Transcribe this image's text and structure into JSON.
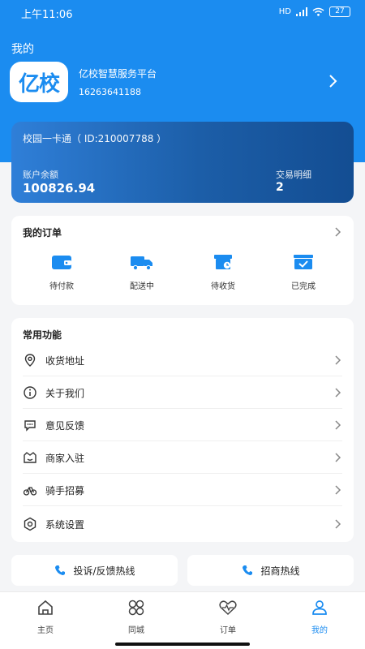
{
  "status_bar": {
    "time": "上午11:06",
    "network": "HD",
    "battery": "27"
  },
  "header": {
    "title": "我的",
    "logo_text": "亿校",
    "platform_name": "亿校智慧服务平台",
    "phone": "16263641188"
  },
  "card": {
    "title": "校园一卡通（ ID:210007788 ）",
    "balance_label": "账户余额",
    "balance_value": "100826.94",
    "transactions_label": "交易明细",
    "transactions_value": "2"
  },
  "orders": {
    "title": "我的订单",
    "items": [
      {
        "label": "待付款",
        "icon": "wallet-icon"
      },
      {
        "label": "配送中",
        "icon": "truck-icon"
      },
      {
        "label": "待收货",
        "icon": "package-clock-icon"
      },
      {
        "label": "已完成",
        "icon": "checked-box-icon"
      }
    ]
  },
  "functions": {
    "title": "常用功能",
    "items": [
      {
        "label": "收货地址",
        "icon": "location-icon"
      },
      {
        "label": "关于我们",
        "icon": "info-icon"
      },
      {
        "label": "意见反馈",
        "icon": "feedback-icon"
      },
      {
        "label": "商家入驻",
        "icon": "shop-icon"
      },
      {
        "label": "骑手招募",
        "icon": "bicycle-icon"
      },
      {
        "label": "系统设置",
        "icon": "settings-icon"
      }
    ]
  },
  "hotlines": {
    "complaint": "投诉/反馈热线",
    "business": "招商热线"
  },
  "tabbar": {
    "items": [
      {
        "label": "主页",
        "icon": "home-icon"
      },
      {
        "label": "同城",
        "icon": "grid-icon"
      },
      {
        "label": "订单",
        "icon": "heart-pulse-icon"
      },
      {
        "label": "我的",
        "icon": "person-icon"
      }
    ],
    "active": "我的"
  },
  "colors": {
    "primary": "#1b8cf0",
    "card_gradient_start": "#2f7fd8",
    "card_gradient_end": "#134d92",
    "background": "#f4f5f7"
  }
}
